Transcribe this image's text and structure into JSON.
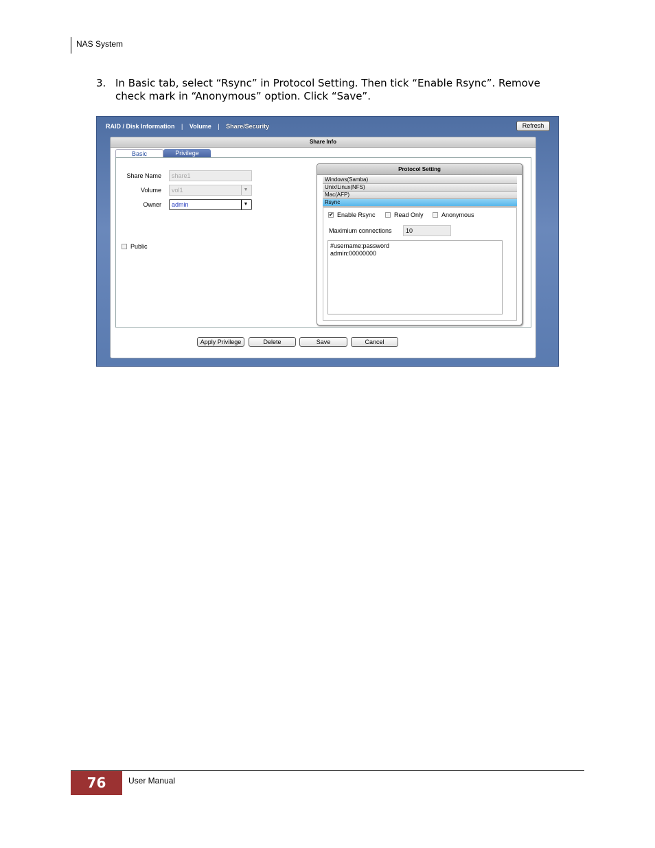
{
  "header": {
    "title": "NAS System"
  },
  "instruction": {
    "number": "3.",
    "text": "In Basic tab, select “Rsync” in Protocol Setting. Then tick “Enable Rsync”. Remove check mark in “Anonymous” option. Click “Save”."
  },
  "screenshot": {
    "nav": [
      {
        "label": "RAID / Disk Information"
      },
      {
        "label": "Volume"
      },
      {
        "label": "Share/Security"
      }
    ],
    "nav_separator": "|",
    "refresh_label": "Refresh",
    "panel_title": "Share Info",
    "tabs": {
      "basic": "Basic",
      "privilege": "Privilege"
    },
    "share_name": {
      "label": "Share Name",
      "value": "share1"
    },
    "volume": {
      "label": "Volume",
      "value": "vol1"
    },
    "owner": {
      "label": "Owner",
      "value": "admin"
    },
    "dropdown_arrow": "▼",
    "public_label": "Public",
    "protocol": {
      "title": "Protocol Setting",
      "items": [
        "Windows(Samba)",
        "Unix/Linux(NFS)",
        "Mac(AFP)",
        "Rsync"
      ],
      "selected": "Rsync",
      "enable_rsync": {
        "label": "Enable Rsync",
        "checked": true,
        "mark": "✔"
      },
      "read_only": {
        "label": "Read Only",
        "checked": false
      },
      "anonymous": {
        "label": "Anonymous",
        "checked": false
      },
      "max_connections": {
        "label": "Maximium connections",
        "value": "10"
      },
      "accounts_line1": "#username:password",
      "accounts_line2": "admin:00000000"
    },
    "buttons": {
      "apply_privilege": "Apply Privilege",
      "delete": "Delete",
      "save": "Save",
      "cancel": "Cancel"
    }
  },
  "footer": {
    "page_number": "76",
    "text": "User Manual"
  }
}
